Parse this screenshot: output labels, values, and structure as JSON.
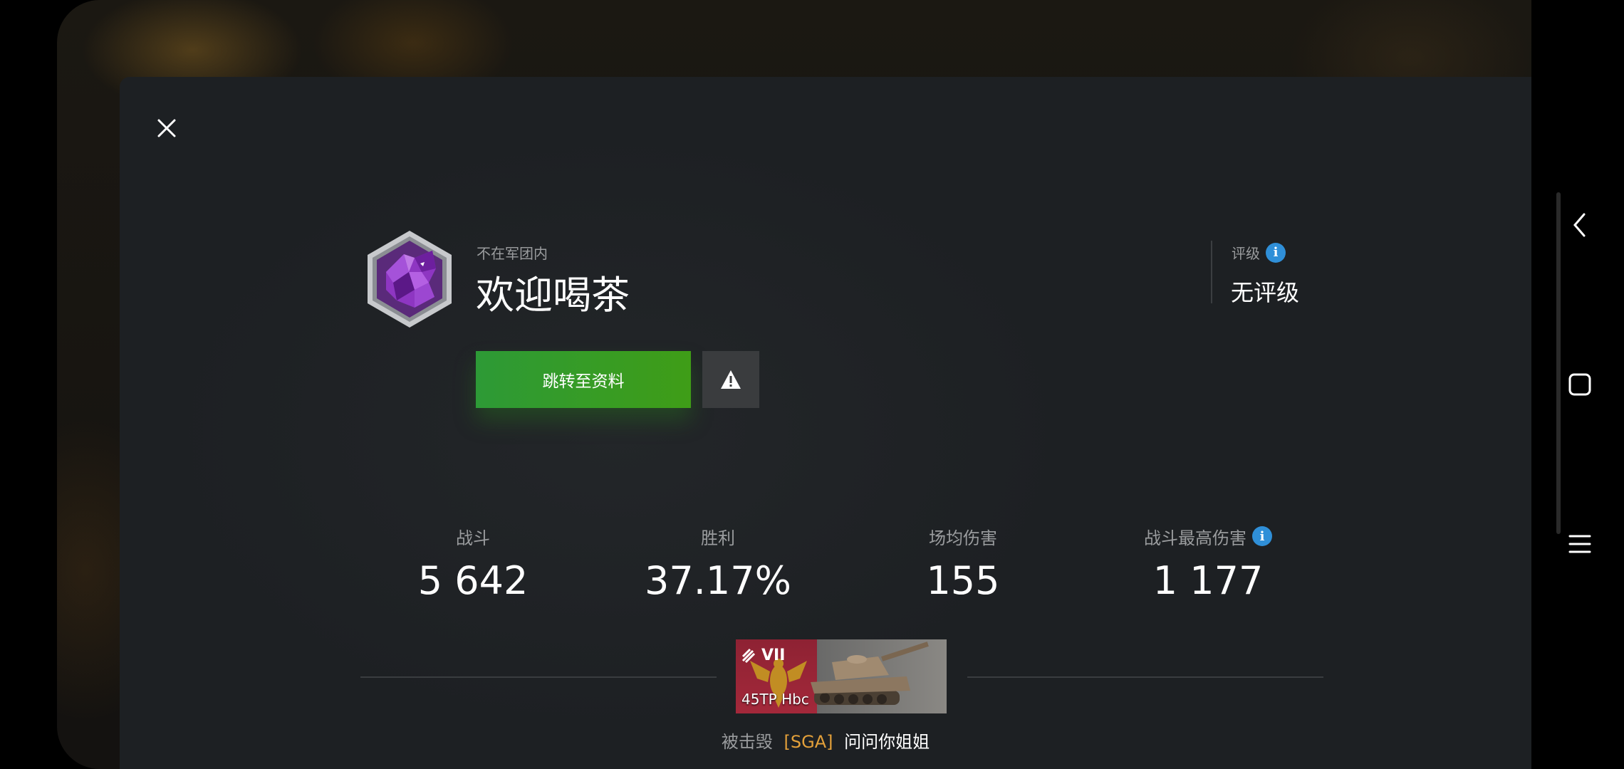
{
  "player": {
    "clan_status": "不在军团内",
    "name": "欢迎喝茶"
  },
  "actions": {
    "profile_button": "跳转至资料"
  },
  "rating": {
    "label": "评级",
    "value": "无评级"
  },
  "stats": [
    {
      "label": "战斗",
      "value": "5 642"
    },
    {
      "label": "胜利",
      "value": "37.17%"
    },
    {
      "label": "场均伤害",
      "value": "155"
    },
    {
      "label": "战斗最高伤害",
      "value": "1 177"
    }
  ],
  "tank": {
    "tier": "VII",
    "name": "45TP Hbc"
  },
  "killed_by": {
    "prefix": "被击毁",
    "clan": "[SGA]",
    "player": "问问你姐姐"
  },
  "colors": {
    "accent_green": "#2d9a36",
    "info_blue": "#2f8fd8",
    "clan_orange": "#e3a03a"
  },
  "icons": [
    "close-icon",
    "warning-icon",
    "info-icon",
    "back-icon",
    "home-icon",
    "menu-icon"
  ]
}
